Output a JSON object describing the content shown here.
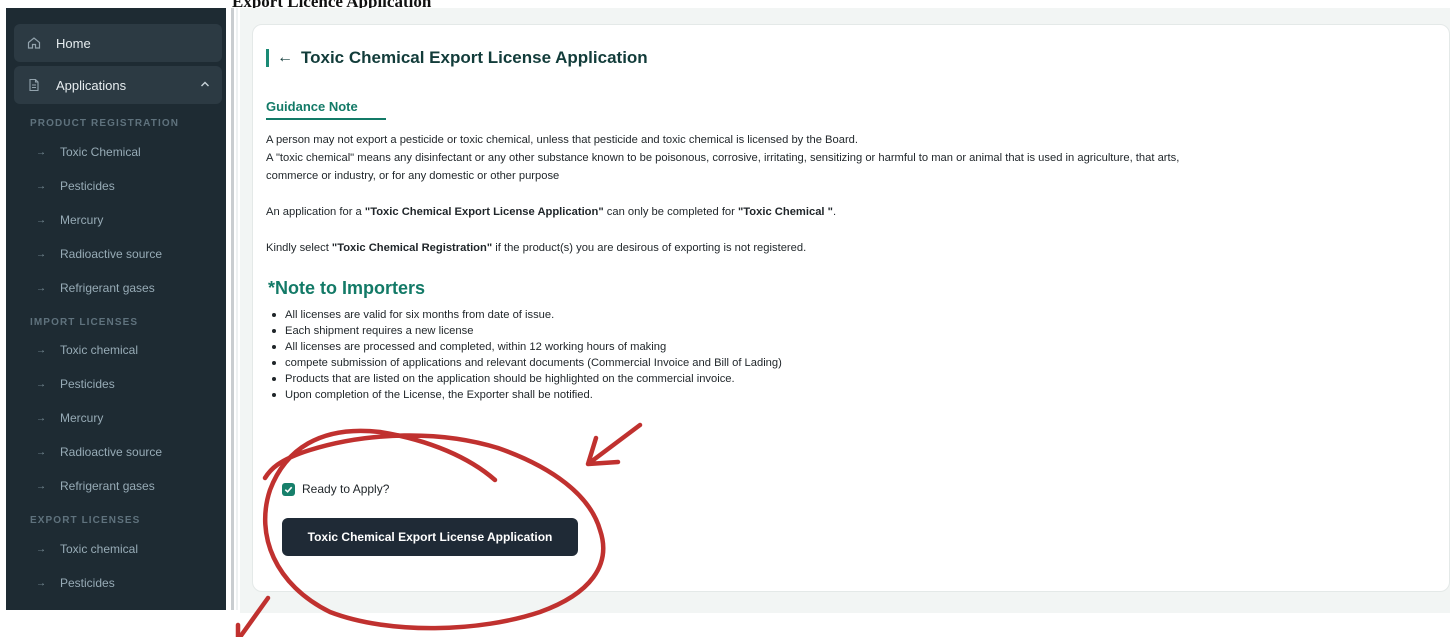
{
  "top_title": "Export Licence Application",
  "sidebar": {
    "home": "Home",
    "applications": "Applications",
    "sections": [
      {
        "heading": "PRODUCT REGISTRATION",
        "items": [
          "Toxic Chemical",
          "Pesticides",
          "Mercury",
          "Radioactive source",
          "Refrigerant gases"
        ]
      },
      {
        "heading": "IMPORT LICENSES",
        "items": [
          "Toxic chemical",
          "Pesticides",
          "Mercury",
          "Radioactive source",
          "Refrigerant gases"
        ]
      },
      {
        "heading": "EXPORT LICENSES",
        "items": [
          "Toxic chemical",
          "Pesticides"
        ]
      }
    ]
  },
  "main": {
    "title": "Toxic Chemical Export License Application",
    "guidance_title": "Guidance Note",
    "para1": "A person may not export a pesticide or toxic chemical, unless that pesticide and toxic chemical is licensed by the Board.",
    "para2_line1": "A \"toxic chemical\" means any disinfectant or any other substance known to be poisonous, corrosive, irritating, sensitizing or harmful to man or animal that is used in agriculture, that arts,",
    "para2_line2": "commerce or industry, or for any domestic or other purpose",
    "para3_prefix": "An application for a ",
    "para3_bold1": "\"Toxic Chemical Export License Application\"",
    "para3_mid": " can only be completed for ",
    "para3_bold2": "\"Toxic Chemical \"",
    "para3_suffix": ".",
    "para4_prefix": "Kindly select ",
    "para4_bold": "\"Toxic Chemical Registration\"",
    "para4_suffix": " if the product(s) you are desirous of exporting is not registered.",
    "note_title": "*Note to Importers",
    "notes": [
      "All licenses are valid for six months from date of issue.",
      "Each shipment requires a new license",
      "All licenses are processed and completed, within 12 working hours of making",
      "compete submission of applications and relevant documents (Commercial Invoice and Bill of Lading)",
      "Products that are listed on the application should be highlighted on the commercial invoice.",
      "Upon completion of the License, the Exporter shall be notified."
    ],
    "checkbox_label": "Ready to Apply?",
    "checkbox_checked": true,
    "apply_button": "Toxic Chemical Export License Application"
  },
  "colors": {
    "sidebar_bg": "#1e2b33",
    "accent_green": "#137a67",
    "button_dark": "#1f2a36",
    "annotation_red": "#c0312f"
  }
}
